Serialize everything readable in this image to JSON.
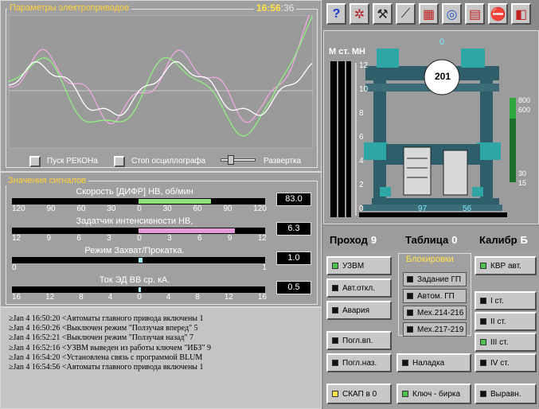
{
  "graph": {
    "title": "Параметры электроприводов",
    "time_hm": "16:56",
    "time_s": ":36",
    "controls": [
      {
        "label": "Пуск РЕКОНа"
      },
      {
        "label": "Стоп осциллографа"
      }
    ],
    "sweep_label": "Развертка"
  },
  "signals": {
    "title": "Значения сигналов",
    "items": [
      {
        "label": "Скорость [ДИФР] НВ, об/мин",
        "value": "83.0",
        "ticks": [
          "120",
          "90",
          "60",
          "30",
          "0",
          "30",
          "60",
          "90",
          "120"
        ],
        "level": 0.57,
        "color": "#8ee07a"
      },
      {
        "label": "Задатчик интенсивности НВ,",
        "value": "6.3",
        "ticks": [
          "12",
          "9",
          "6",
          "3",
          "0",
          "3",
          "6",
          "9",
          "12"
        ],
        "level": 0.76,
        "color": "#e79ad9"
      },
      {
        "label": "Режим Захват/Прокатка.",
        "value": "1.0",
        "ticks": [
          "0",
          "1"
        ],
        "level": 0.03,
        "color": "#9ee8f0"
      },
      {
        "label": "Ток ЭД ВВ ср. кА.",
        "value": "0.5",
        "ticks": [
          "16",
          "12",
          "8",
          "4",
          "0",
          "4",
          "8",
          "12",
          "16"
        ],
        "level": 0.02,
        "color": "#9ee8f0"
      }
    ]
  },
  "log": [
    "≥Jan 4 16:50:20  <Автоматы главного привода включены 1",
    "≥Jan 4 16:50:26  <Выключен режим \"Ползучая вперед\" 5",
    "≥Jan 4 16:52:21  <Выключен режим \"Ползучая назад\"  7",
    "≥Jan 4 16:52:16  <УЗВМ выведен из работы ключем \"ИБЗ\" 9",
    "≥Jan 4 16:54:20  <Установлена связь с программой BLUM",
    "≥Jan 4 16:54:56  <Автоматы главного привода включены 1"
  ],
  "toolbar": [
    "help-icon",
    "trend-icon",
    "tools-icon",
    "signal-icon",
    "table-icon",
    "network-icon",
    "calendar-icon",
    "stop-icon",
    "exit-icon"
  ],
  "mill": {
    "axis_label": "М ст. МН",
    "axis_ticks": [
      "12",
      "10",
      "8",
      "6",
      "4",
      "2",
      "0"
    ],
    "top_value": "0",
    "roll_value": "201",
    "bottom_left": "97",
    "bottom_right": "56",
    "scale_ticks": [
      "800",
      "600",
      "30",
      "15"
    ]
  },
  "status": {
    "pass_label": "Проход",
    "pass_value": "9",
    "table_label": "Таблица",
    "table_value": "0",
    "caliber_label": "Калибр",
    "caliber_value": "Б"
  },
  "controls": {
    "col1": [
      {
        "label": "УЗВМ",
        "led": "#4fc04f"
      },
      {
        "label": "Авт.откл.",
        "led": "#111"
      },
      {
        "label": "Авария",
        "led": "#111"
      },
      {
        "label": "Погл.вп.",
        "led": "#111"
      },
      {
        "label": "Погл.наз.",
        "led": "#111"
      }
    ],
    "block_title": "Блокировки",
    "block": [
      {
        "label": "Задание ГП"
      },
      {
        "label": "Автом. ГП"
      },
      {
        "label": "Мех.214-216"
      },
      {
        "label": "Мех.217-219"
      }
    ],
    "nastroyka": "Наладка",
    "col3": [
      {
        "label": "КВР авт.",
        "led": "#4fc04f"
      },
      {
        "label": "I ст.",
        "led": "#111"
      },
      {
        "label": "II ст.",
        "led": "#111"
      },
      {
        "label": "III ст.",
        "led": "#4fc04f"
      },
      {
        "label": "IV ст.",
        "led": "#111"
      }
    ],
    "bottom": [
      {
        "label": "СКАП в 0",
        "led": "#ffe24a"
      },
      {
        "label": "Ключ - бирка",
        "led": "#4fc04f"
      },
      {
        "label": "Выравн.",
        "led": "#111"
      }
    ]
  }
}
